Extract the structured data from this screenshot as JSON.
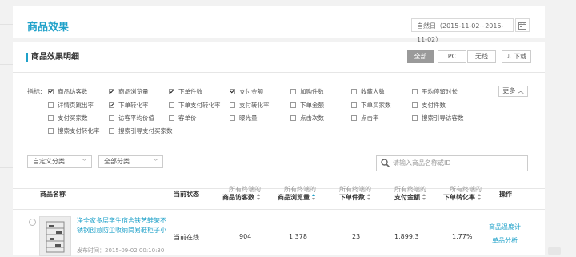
{
  "page": {
    "title": "商品效果",
    "date_range": "自然日（2015-11-02~2015-11-02）"
  },
  "detail": {
    "title": "商品效果明细",
    "device_tabs": [
      "全部",
      "PC",
      "无线"
    ],
    "download_label": "下载"
  },
  "filters": {
    "label": "指标:",
    "more_label": "更多",
    "metrics": [
      {
        "label": "商品访客数",
        "checked": true
      },
      {
        "label": "商品浏览量",
        "checked": true
      },
      {
        "label": "下单件数",
        "checked": true
      },
      {
        "label": "支付金额",
        "checked": true
      },
      {
        "label": "加购件数",
        "checked": false
      },
      {
        "label": "收藏人数",
        "checked": false
      },
      {
        "label": "平均停留时长",
        "checked": false
      },
      {
        "label": "详情页跳出率",
        "checked": false
      },
      {
        "label": "下单转化率",
        "checked": true
      },
      {
        "label": "下单支付转化率",
        "checked": false
      },
      {
        "label": "支付转化率",
        "checked": false
      },
      {
        "label": "下单金额",
        "checked": false
      },
      {
        "label": "下单买家数",
        "checked": false
      },
      {
        "label": "支付件数",
        "checked": false
      },
      {
        "label": "支付买家数",
        "checked": false
      },
      {
        "label": "访客平均价值",
        "checked": false
      },
      {
        "label": "客单价",
        "checked": false
      },
      {
        "label": "曝光量",
        "checked": false
      },
      {
        "label": "点击次数",
        "checked": false
      },
      {
        "label": "点击率",
        "checked": false
      },
      {
        "label": "搜索引导访客数",
        "checked": false
      },
      {
        "label": "搜索支付转化率",
        "checked": false
      },
      {
        "label": "搜索引导支付买家数",
        "checked": false
      }
    ]
  },
  "toolbar": {
    "custom_category": "自定义分类",
    "all_category": "全部分类",
    "search_placeholder": "请输入商品名称或ID"
  },
  "table": {
    "col_name": "商品名称",
    "col_status": "当前状态",
    "metric_prefix": "所有终端的",
    "col_visitors": "商品访客数",
    "col_pv": "商品浏览量",
    "col_order_qty": "下单件数",
    "col_pay_amount": "支付金额",
    "col_order_rate": "下单转化率",
    "col_ops": "操作",
    "rows": [
      {
        "name": "净全家多层学生宿舍铁艺鞋架不锈钢创意防尘收纳简易鞋柜子小",
        "publish_time": "发布时间：2015-09-02 00:10:30",
        "status": "当前在线",
        "visitors": "904",
        "pv": "1,378",
        "order_qty": "23",
        "pay_amount": "1,899.3",
        "order_rate": "1.77%",
        "op1": "商品温度计",
        "op2": "单品分析"
      }
    ]
  }
}
